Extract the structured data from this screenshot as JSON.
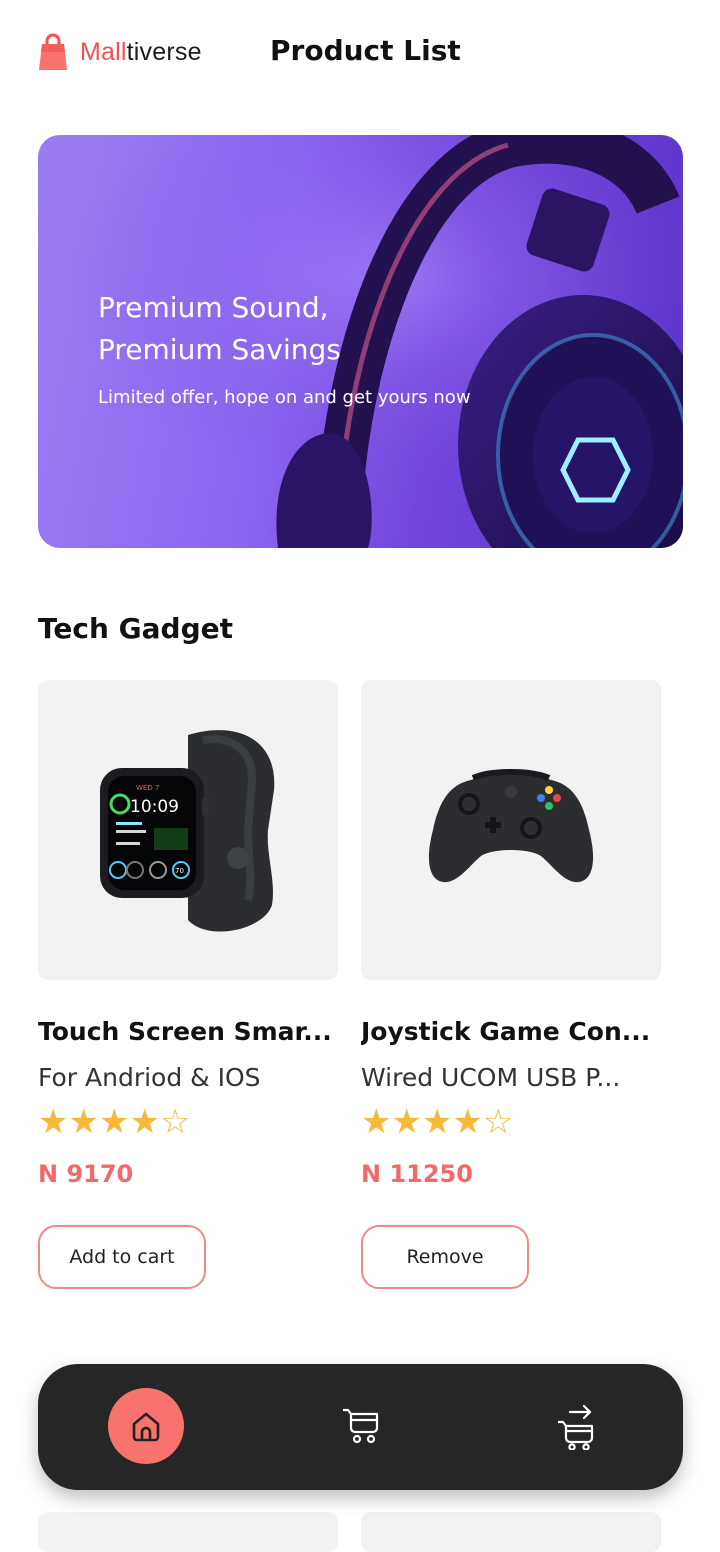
{
  "header": {
    "logo": {
      "accent": "Mall",
      "rest": "tiverse"
    },
    "title": "Product List"
  },
  "banner": {
    "headline_line1": "Premium Sound,",
    "headline_line2": "Premium Savings",
    "subtitle": "Limited offer, hope on and get yours now"
  },
  "section": {
    "title": "Tech Gadget"
  },
  "products": [
    {
      "title": "Touch Screen Smar...",
      "subtitle": "For Andriod & IOS",
      "rating": 4,
      "rating_max": 5,
      "stars_filled": "★★★★",
      "stars_empty": "☆",
      "price": "N 9170",
      "button_label": "Add to cart",
      "image_icon": "smartwatch-icon"
    },
    {
      "title": "Joystick Game Con...",
      "subtitle": "Wired UCOM USB P...",
      "rating": 4,
      "rating_max": 5,
      "stars_filled": "★★★★",
      "stars_empty": "☆",
      "price": "N 11250",
      "button_label": "Remove",
      "image_icon": "game-controller-icon"
    }
  ],
  "watch_face": {
    "day": "WED 7",
    "time": "10:09",
    "complication": "70"
  },
  "bottom_nav": {
    "items": [
      {
        "icon": "home-icon",
        "active": true
      },
      {
        "icon": "cart-icon",
        "active": false
      },
      {
        "icon": "checkout-cart-icon",
        "active": false
      }
    ]
  },
  "colors": {
    "accent": "#f8736e",
    "price": "#f06a6a",
    "star": "#f6b93b",
    "nav_bg": "#262626",
    "banner": "#8a66f0"
  }
}
